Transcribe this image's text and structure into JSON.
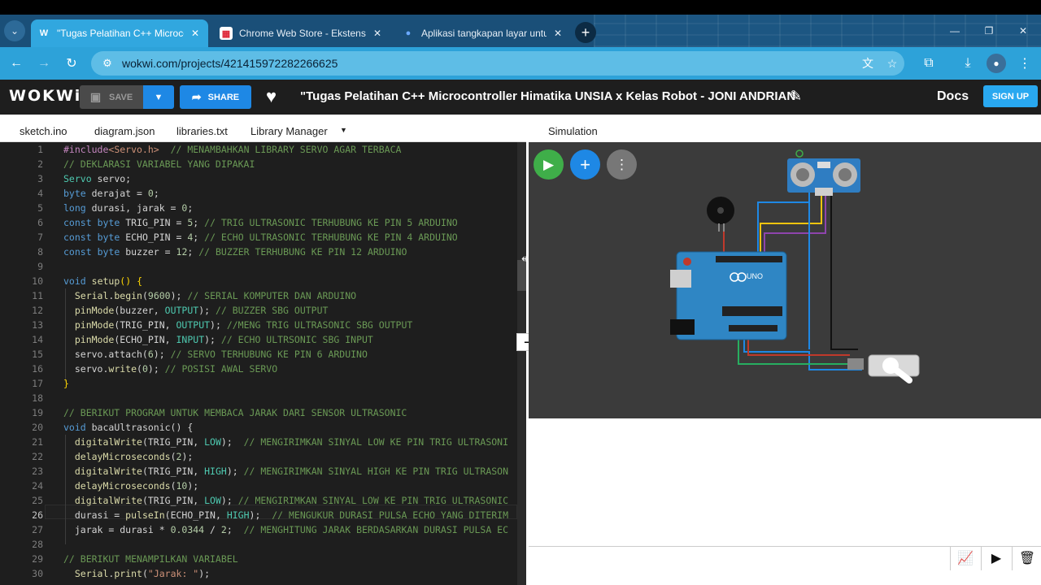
{
  "browser": {
    "tabs": [
      {
        "label": "\"Tugas Pelatihan C++ Microco",
        "favicon": "W"
      },
      {
        "label": "Chrome Web Store - Ekstensi",
        "favicon": "▦"
      },
      {
        "label": "Aplikasi tangkapan layar untuk",
        "favicon": "●"
      }
    ],
    "tab_close": "✕",
    "new_tab": "+",
    "url": "wokwi.com/projects/421415972282266625",
    "window_controls": [
      "—",
      "❐",
      "✕"
    ]
  },
  "wokwi": {
    "logo": "WOKWi",
    "save_label": "SAVE",
    "share_label": "SHARE",
    "project_title": "\"Tugas Pelatihan C++ Microcontroller Himatika UNSIA x Kelas Robot - JONI ANDRIAN",
    "docs": "Docs",
    "signup": "SIGN UP",
    "file_tabs": [
      "sketch.ino",
      "diagram.json",
      "libraries.txt",
      "Library Manager"
    ],
    "sim_title": "Simulation",
    "board_label": "UNO",
    "collapse": "−"
  },
  "colors": {
    "tab_active": "#31a7df",
    "toolbar": "#2da2d9",
    "accent": "#1e88e5",
    "editor_bg": "#1e1e1e",
    "sim_bg": "#3b3b3b"
  },
  "editor": {
    "current_line": 26,
    "lines": [
      [
        [
          "pp",
          "#include"
        ],
        [
          "st",
          "<Servo.h>"
        ],
        [
          "t",
          "  "
        ],
        [
          "cm",
          "// MENAMBAHKAN LIBRARY SERVO AGAR TERBACA"
        ]
      ],
      [
        [
          "cm",
          "// DEKLARASI VARIABEL YANG DIPAKAI"
        ]
      ],
      [
        [
          "ty",
          "Servo"
        ],
        [
          "t",
          " servo;"
        ]
      ],
      [
        [
          "kw",
          "byte"
        ],
        [
          "t",
          " derajat = "
        ],
        [
          "nm",
          "0"
        ],
        [
          "t",
          ";"
        ]
      ],
      [
        [
          "kw",
          "long"
        ],
        [
          "t",
          " durasi, jarak = "
        ],
        [
          "nm",
          "0"
        ],
        [
          "t",
          ";"
        ]
      ],
      [
        [
          "kw",
          "const"
        ],
        [
          "t",
          " "
        ],
        [
          "kw",
          "byte"
        ],
        [
          "t",
          " TRIG_PIN = "
        ],
        [
          "nm",
          "5"
        ],
        [
          "t",
          "; "
        ],
        [
          "cm",
          "// TRIG ULTRASONIC TERHUBUNG KE PIN 5 ARDUINO"
        ]
      ],
      [
        [
          "kw",
          "const"
        ],
        [
          "t",
          " "
        ],
        [
          "kw",
          "byte"
        ],
        [
          "t",
          " ECHO_PIN = "
        ],
        [
          "nm",
          "4"
        ],
        [
          "t",
          "; "
        ],
        [
          "cm",
          "// ECHO ULTRASONIC TERHUBUNG KE PIN 4 ARDUINO"
        ]
      ],
      [
        [
          "kw",
          "const"
        ],
        [
          "t",
          " "
        ],
        [
          "kw",
          "byte"
        ],
        [
          "t",
          " buzzer = "
        ],
        [
          "nm",
          "12"
        ],
        [
          "t",
          "; "
        ],
        [
          "cm",
          "// BUZZER TERHUBUNG KE PIN 12 ARDUINO"
        ]
      ],
      [],
      [
        [
          "kw",
          "void"
        ],
        [
          "t",
          " "
        ],
        [
          "fn",
          "setup"
        ],
        [
          "par",
          "()"
        ],
        [
          "t",
          " "
        ],
        [
          "par",
          "{"
        ]
      ],
      [
        [
          "t",
          "  "
        ],
        [
          "fn",
          "Serial"
        ],
        [
          "t",
          "."
        ],
        [
          "fn",
          "begin"
        ],
        [
          "t",
          "("
        ],
        [
          "nm",
          "9600"
        ],
        [
          "t",
          "); "
        ],
        [
          "cm",
          "// SERIAL KOMPUTER DAN ARDUINO"
        ]
      ],
      [
        [
          "t",
          "  "
        ],
        [
          "fn",
          "pinMode"
        ],
        [
          "t",
          "(buzzer, "
        ],
        [
          "cs",
          "OUTPUT"
        ],
        [
          "t",
          "); "
        ],
        [
          "cm",
          "// BUZZER SBG OUTPUT"
        ]
      ],
      [
        [
          "t",
          "  "
        ],
        [
          "fn",
          "pinMode"
        ],
        [
          "t",
          "(TRIG_PIN, "
        ],
        [
          "cs",
          "OUTPUT"
        ],
        [
          "t",
          "); "
        ],
        [
          "cm",
          "//MENG TRIG ULTRASONIC SBG OUTPUT"
        ]
      ],
      [
        [
          "t",
          "  "
        ],
        [
          "fn",
          "pinMode"
        ],
        [
          "t",
          "(ECHO_PIN, "
        ],
        [
          "cs",
          "INPUT"
        ],
        [
          "t",
          "); "
        ],
        [
          "cm",
          "// ECHO ULTRSONIC SBG INPUT"
        ]
      ],
      [
        [
          "t",
          "  servo.attach("
        ],
        [
          "nm",
          "6"
        ],
        [
          "t",
          "); "
        ],
        [
          "cm",
          "// SERVO TERHUBUNG KE PIN 6 ARDUINO"
        ]
      ],
      [
        [
          "t",
          "  servo."
        ],
        [
          "fn",
          "write"
        ],
        [
          "t",
          "("
        ],
        [
          "nm",
          "0"
        ],
        [
          "t",
          "); "
        ],
        [
          "cm",
          "// POSISI AWAL SERVO"
        ]
      ],
      [
        [
          "par",
          "}"
        ]
      ],
      [],
      [
        [
          "cm",
          "// BERIKUT PROGRAM UNTUK MEMBACA JARAK DARI SENSOR ULTRASONIC"
        ]
      ],
      [
        [
          "kw",
          "void"
        ],
        [
          "t",
          " bacaUltrasonic() {"
        ]
      ],
      [
        [
          "t",
          "  "
        ],
        [
          "fn",
          "digitalWrite"
        ],
        [
          "t",
          "(TRIG_PIN, "
        ],
        [
          "cs",
          "LOW"
        ],
        [
          "t",
          ");  "
        ],
        [
          "cm",
          "// MENGIRIMKAN SINYAL LOW KE PIN TRIG ULTRASONI"
        ]
      ],
      [
        [
          "t",
          "  "
        ],
        [
          "fn",
          "delayMicroseconds"
        ],
        [
          "t",
          "("
        ],
        [
          "nm",
          "2"
        ],
        [
          "t",
          ");"
        ]
      ],
      [
        [
          "t",
          "  "
        ],
        [
          "fn",
          "digitalWrite"
        ],
        [
          "t",
          "(TRIG_PIN, "
        ],
        [
          "cs",
          "HIGH"
        ],
        [
          "t",
          "); "
        ],
        [
          "cm",
          "// MENGIRIMKAN SINYAL HIGH KE PIN TRIG ULTRASON"
        ]
      ],
      [
        [
          "t",
          "  "
        ],
        [
          "fn",
          "delayMicroseconds"
        ],
        [
          "t",
          "("
        ],
        [
          "nm",
          "10"
        ],
        [
          "t",
          ");"
        ]
      ],
      [
        [
          "t",
          "  "
        ],
        [
          "fn",
          "digitalWrite"
        ],
        [
          "t",
          "(TRIG_PIN, "
        ],
        [
          "cs",
          "LOW"
        ],
        [
          "t",
          "); "
        ],
        [
          "cm",
          "// MENGIRIMKAN SINYAL LOW KE PIN TRIG ULTRASONIC"
        ]
      ],
      [
        [
          "t",
          "  durasi = "
        ],
        [
          "fn",
          "pulseIn"
        ],
        [
          "t",
          "(ECHO_PIN, "
        ],
        [
          "cs",
          "HIGH"
        ],
        [
          "t",
          ");  "
        ],
        [
          "cm",
          "// MENGUKUR DURASI PULSA ECHO YANG DITERIM"
        ]
      ],
      [
        [
          "t",
          "  jarak = durasi * "
        ],
        [
          "nm",
          "0.0344"
        ],
        [
          "t",
          " / "
        ],
        [
          "nm",
          "2"
        ],
        [
          "t",
          ";  "
        ],
        [
          "cm",
          "// MENGHITUNG JARAK BERDASARKAN DURASI PULSA EC"
        ]
      ],
      [],
      [
        [
          "cm",
          "// BERIKUT MENAMPILKAN VARIABEL"
        ]
      ],
      [
        [
          "t",
          "  "
        ],
        [
          "fn",
          "Serial"
        ],
        [
          "t",
          "."
        ],
        [
          "fn",
          "print"
        ],
        [
          "t",
          "("
        ],
        [
          "st",
          "\"Jarak: \""
        ],
        [
          "t",
          ");"
        ]
      ]
    ]
  }
}
